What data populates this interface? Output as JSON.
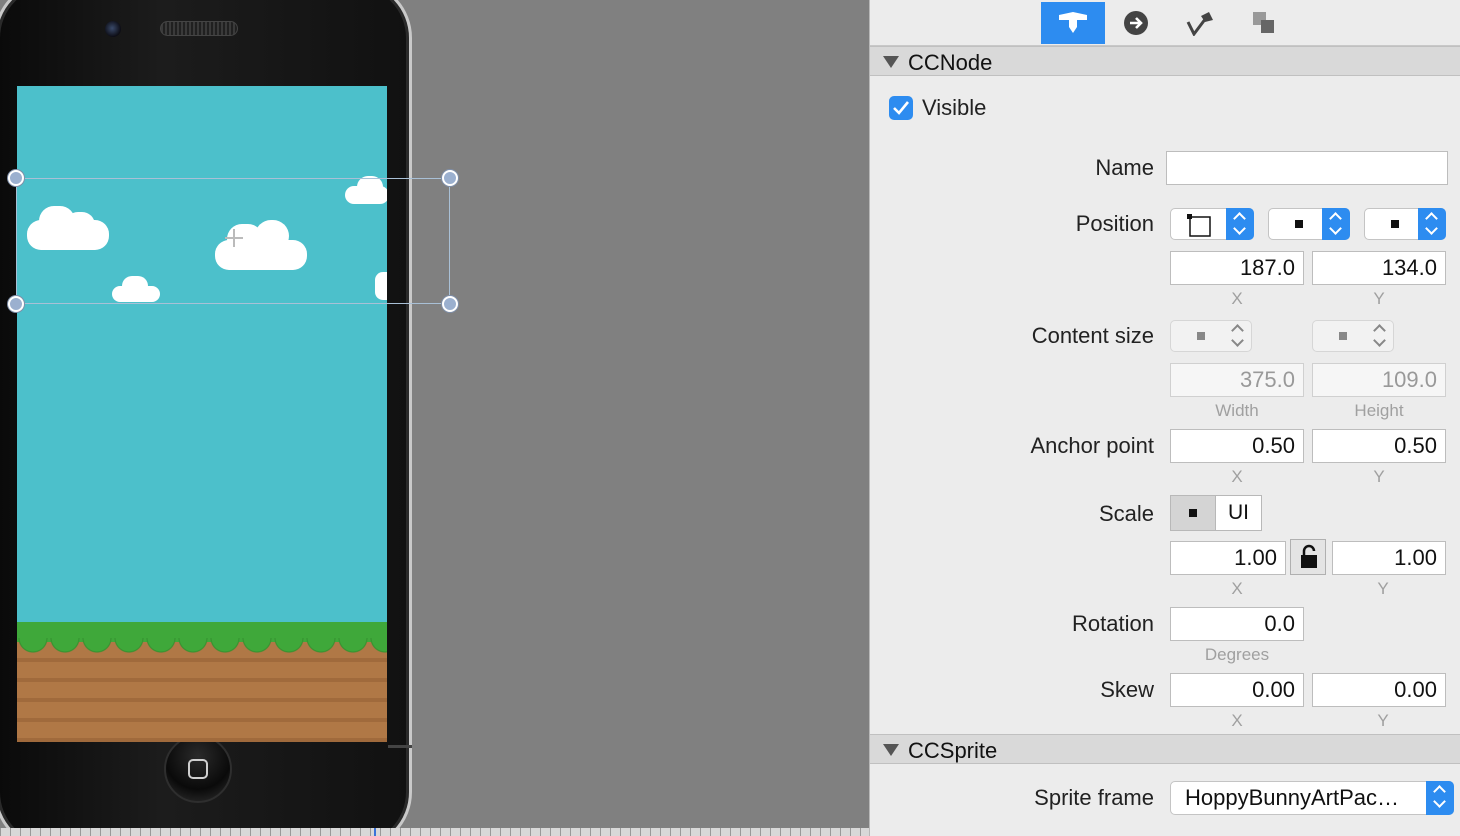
{
  "canvas": {
    "screen_bg": "#4cc0cb",
    "selection": "sprite-bounds"
  },
  "toolbar": {
    "tabs": [
      {
        "name": "node-properties-icon",
        "active": true
      },
      {
        "name": "code-connections-icon",
        "active": false
      },
      {
        "name": "item-physics-icon",
        "active": false
      },
      {
        "name": "item-templates-icon",
        "active": false
      }
    ]
  },
  "ccnode": {
    "title": "CCNode",
    "visible_label": "Visible",
    "visible_checked": true,
    "name_label": "Name",
    "name_value": "",
    "position_label": "Position",
    "position_x": "187.0",
    "position_y": "134.0",
    "x_label": "X",
    "y_label": "Y",
    "content_size_label": "Content size",
    "content_width": "375.0",
    "content_height": "109.0",
    "width_label": "Width",
    "height_label": "Height",
    "anchor_label": "Anchor point",
    "anchor_x": "0.50",
    "anchor_y": "0.50",
    "scale_label": "Scale",
    "scale_ui_label": "UI",
    "scale_x": "1.00",
    "scale_y": "1.00",
    "rotation_label": "Rotation",
    "rotation_value": "0.0",
    "degrees_label": "Degrees",
    "skew_label": "Skew",
    "skew_x": "0.00",
    "skew_y": "0.00"
  },
  "ccsprite": {
    "title": "CCSprite",
    "sprite_frame_label": "Sprite frame",
    "sprite_frame_value": "HoppyBunnyArtPac…"
  },
  "colors": {
    "accent": "#2d8cf0",
    "panel_bg": "#ececec",
    "canvas_bg": "#808080"
  }
}
